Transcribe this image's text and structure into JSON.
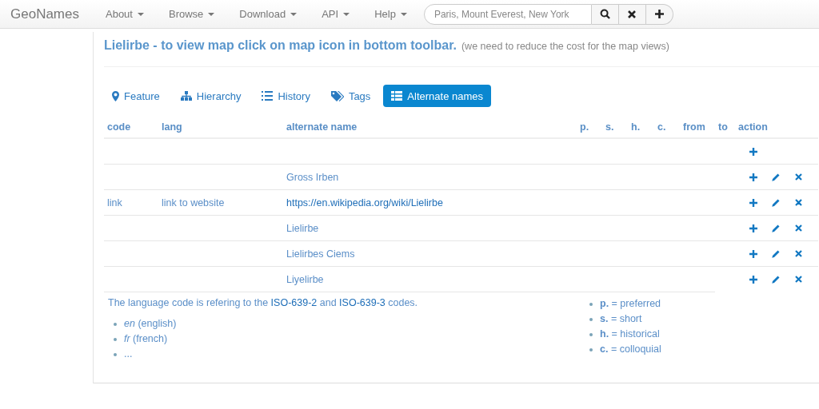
{
  "navbar": {
    "brand": "GeoNames",
    "menus": [
      {
        "label": "About"
      },
      {
        "label": "Browse"
      },
      {
        "label": "Download"
      },
      {
        "label": "API"
      },
      {
        "label": "Help"
      }
    ],
    "search": {
      "placeholder": "Paris, Mount Everest, New York"
    }
  },
  "title": {
    "heading": "Lielirbe - to view map click on map icon in bottom toolbar.",
    "note": "(we need to reduce the cost for the map views)"
  },
  "tabs": [
    {
      "label": "Feature",
      "selected": false
    },
    {
      "label": "Hierarchy",
      "selected": false
    },
    {
      "label": "History",
      "selected": false
    },
    {
      "label": "Tags",
      "selected": false
    },
    {
      "label": "Alternate names",
      "selected": true
    }
  ],
  "table": {
    "columns": [
      "code",
      "lang",
      "alternate name",
      "p.",
      "s.",
      "h.",
      "c.",
      "from",
      "to",
      "action"
    ],
    "rows": [
      {
        "kind": "new"
      },
      {
        "kind": "entry",
        "name": "Gross Irben",
        "link": false
      },
      {
        "kind": "entry",
        "code": "link",
        "lang": "link to website",
        "name": "https://en.wikipedia.org/wiki/Lielirbe",
        "link": true
      },
      {
        "kind": "entry",
        "name": "Lielirbe",
        "link": false
      },
      {
        "kind": "entry",
        "name": "Lielirbes Ciems",
        "link": false
      },
      {
        "kind": "entry",
        "name": "Liyelirbe",
        "link": false
      }
    ]
  },
  "footer": {
    "sentence": [
      {
        "kind": "text",
        "text": "The language code is refering to the "
      },
      {
        "kind": "link",
        "text": "ISO-639-2"
      },
      {
        "kind": "text",
        "text": " and "
      },
      {
        "kind": "link",
        "text": "ISO-639-3"
      },
      {
        "kind": "text",
        "text": " codes."
      }
    ],
    "languages": [
      "*en* (english)",
      "*fr* (french)",
      "..."
    ],
    "legend": [
      "**p.** = preferred",
      "**s.** = short",
      "**h.** = historical",
      "**c.** = colloquial"
    ]
  }
}
